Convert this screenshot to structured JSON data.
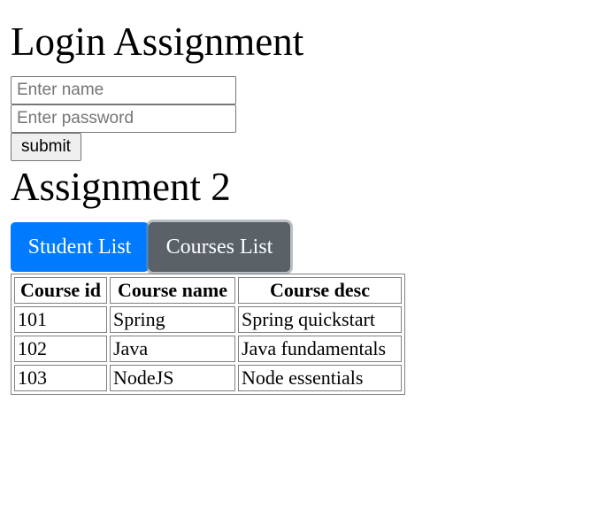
{
  "login": {
    "title": "Login Assignment",
    "name_placeholder": "Enter name",
    "password_placeholder": "Enter password",
    "submit_label": "submit"
  },
  "assignment2": {
    "title": "Assignment 2",
    "tabs": [
      {
        "label": "Student List",
        "color": "#007bff"
      },
      {
        "label": "Courses List",
        "color": "#5a6268"
      }
    ]
  },
  "courses_table": {
    "headers": [
      "Course id",
      "Course name",
      "Course desc"
    ],
    "rows": [
      [
        "101",
        "Spring",
        "Spring quickstart"
      ],
      [
        "102",
        "Java",
        "Java fundamentals"
      ],
      [
        "103",
        "NodeJS",
        "Node essentials"
      ]
    ]
  }
}
